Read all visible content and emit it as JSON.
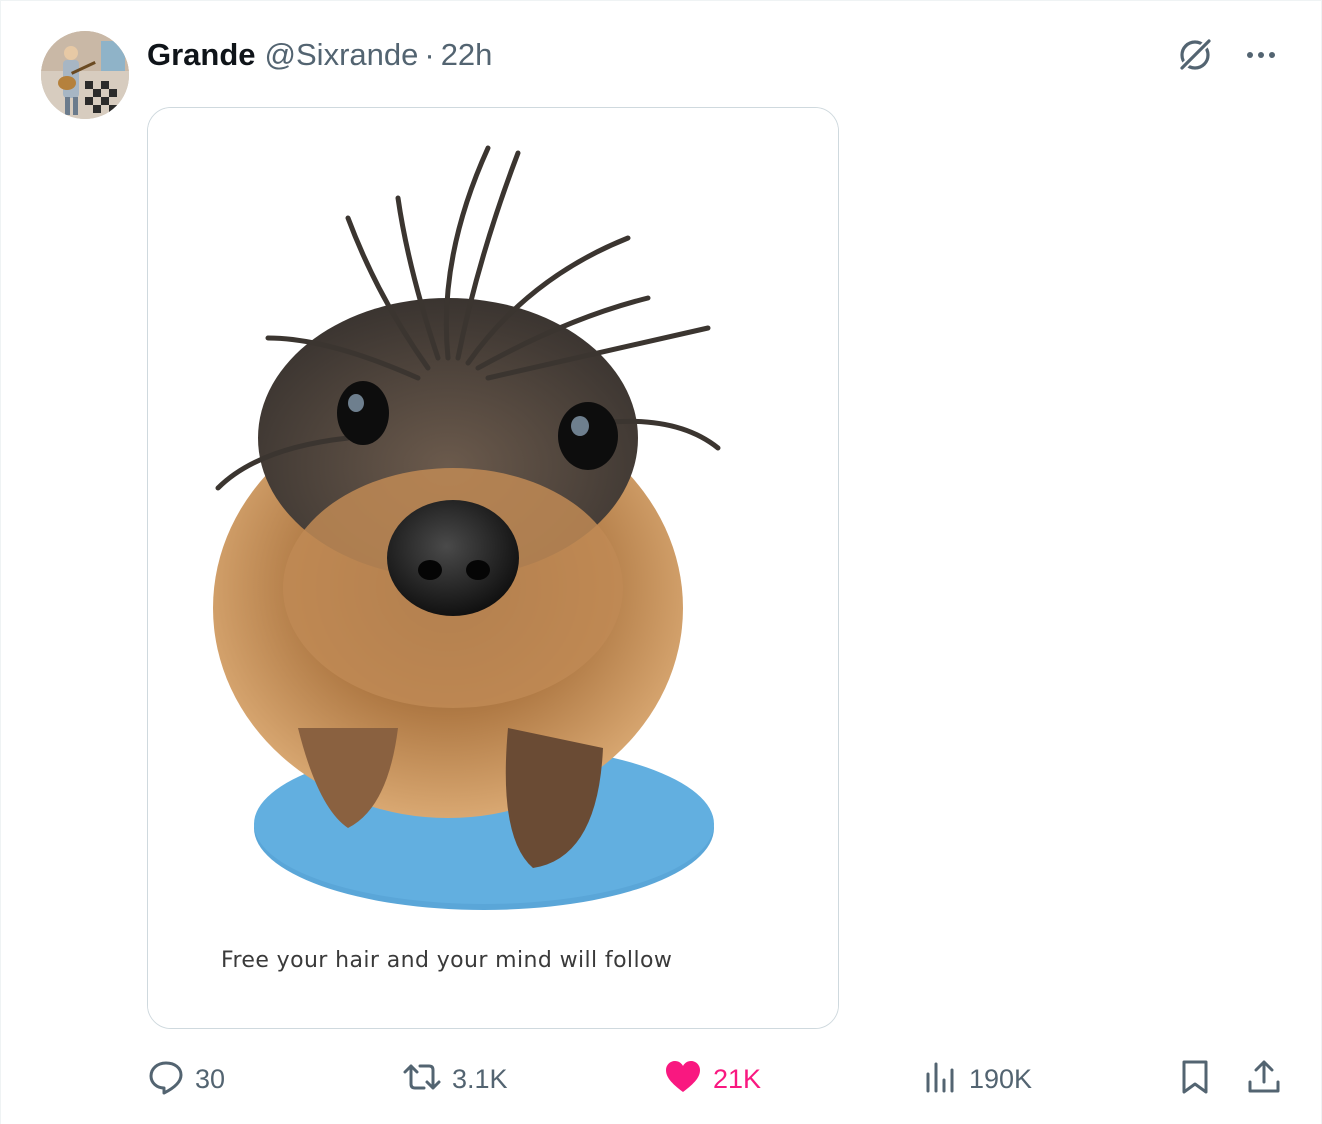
{
  "post": {
    "author": {
      "display_name": "Grande",
      "handle": "@Sixrande"
    },
    "separator": "·",
    "timestamp": "22h",
    "media": {
      "caption": "Free your hair and your mind will follow"
    },
    "metrics": {
      "replies": "30",
      "reposts": "3.1K",
      "likes": "21K",
      "views": "190K"
    },
    "liked": true
  },
  "icons": {
    "more": "more-icon",
    "grok": "grok-icon",
    "reply": "reply-icon",
    "repost": "repost-icon",
    "like": "heart-icon",
    "views": "views-icon",
    "bookmark": "bookmark-icon",
    "share": "share-icon"
  },
  "colors": {
    "text_primary": "#0f1419",
    "text_secondary": "#536471",
    "like_active": "#f91880",
    "border": "#cfd9de"
  }
}
